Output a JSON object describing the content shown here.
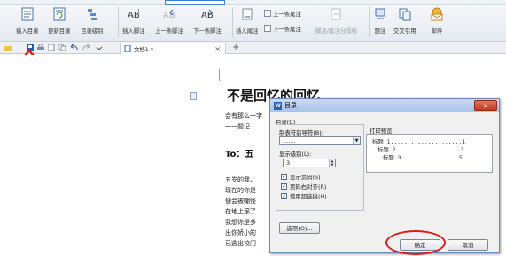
{
  "ribbon": {
    "buttons": [
      {
        "label": "插入目录",
        "icon": "toc-icon"
      },
      {
        "label": "更新目录",
        "icon": "update-toc-icon"
      },
      {
        "label": "目录级别",
        "icon": "toc-level-icon"
      },
      {
        "label": "插入脚注",
        "icon": "footnote-icon"
      },
      {
        "label": "上一条脚注",
        "icon": "prev-footnote-icon"
      },
      {
        "label": "下一条脚注",
        "icon": "next-footnote-icon"
      },
      {
        "label": "插入尾注",
        "icon": "endnote-icon"
      },
      {
        "label": "脚注/尾注分隔线",
        "icon": "separator-icon"
      },
      {
        "label": "题注",
        "icon": "caption-icon"
      },
      {
        "label": "交叉引用",
        "icon": "cross-ref-icon"
      },
      {
        "label": "邮件",
        "icon": "mail-icon"
      }
    ],
    "small_buttons": [
      "上一条尾注",
      "下一条尾注"
    ]
  },
  "tabs": {
    "doc_tab": "文档1 *",
    "close": "×",
    "add": "+"
  },
  "document": {
    "heading": "不是回忆的回忆",
    "lines_top": [
      "会有那么一字",
      "一一题记"
    ],
    "subheading": "To：五",
    "lines_body": [
      "五岁的我，",
      "现在的你是",
      "便会被嘲怪",
      "在地上滚了",
      "我想你是多",
      "出你娇小的",
      "已逃出校门"
    ]
  },
  "dialog": {
    "title": "目录",
    "close": "×",
    "group_label": "目录(C)",
    "leader_label": "制表符前导符(B):",
    "leader_value": ".......",
    "levels_label": "显示级别(L):",
    "levels_value": "3",
    "checkboxes": [
      {
        "label": "显示页码(S)",
        "checked": true
      },
      {
        "label": "页码右对齐(R)",
        "checked": true
      },
      {
        "label": "使用超链接(H)",
        "checked": true
      }
    ],
    "preview_label": "打印预览",
    "preview_lines": [
      "标题 1.....................1",
      "标题 2...................3",
      "标题 3.................5"
    ],
    "options_button": "选项(O)...",
    "ok_button": "确定",
    "cancel_button": "取消"
  },
  "colors": {
    "annotation": "#e01a1a",
    "dialog_title": "#a9c3ea",
    "accent": "#2a5db0"
  }
}
